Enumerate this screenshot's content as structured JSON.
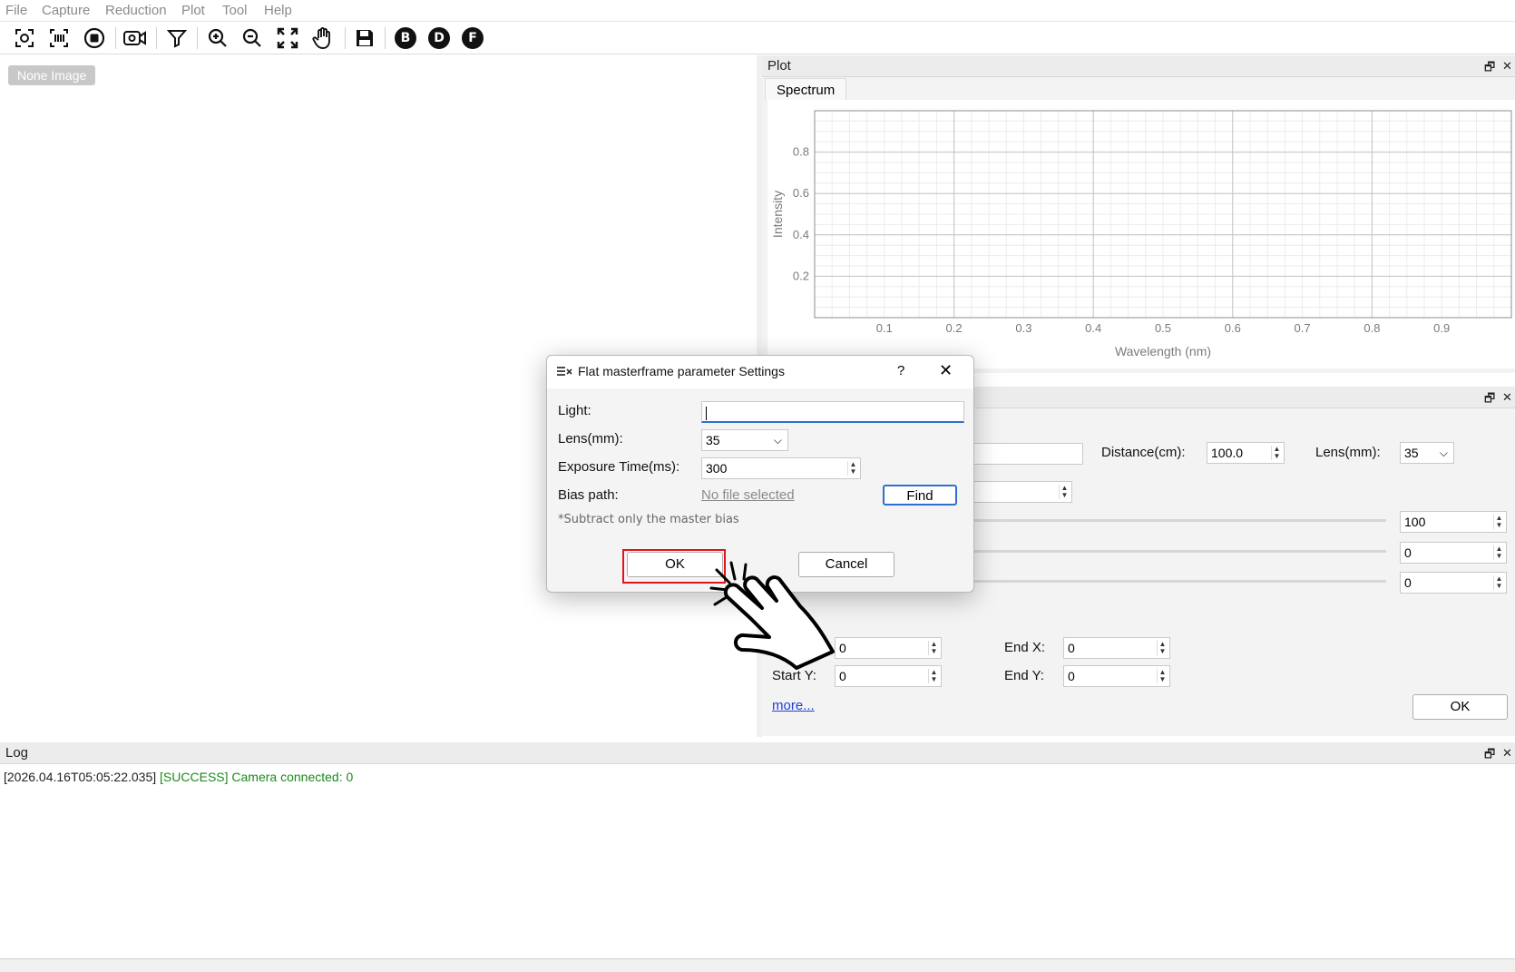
{
  "menu": [
    "File",
    "Capture",
    "Reduction",
    "Plot",
    "Tool",
    "Help"
  ],
  "toolbar": {
    "letters": [
      "B",
      "D",
      "F"
    ]
  },
  "image_area": {
    "badge": "None Image"
  },
  "plot_dock": {
    "title": "Plot",
    "tab": "Spectrum",
    "chart_data": {
      "type": "line",
      "title": "",
      "xlabel": "Wavelength (nm)",
      "ylabel": "Intensity",
      "xlim": [
        0,
        1
      ],
      "ylim": [
        0,
        1
      ],
      "x_ticks": [
        "0.1",
        "0.2",
        "0.3",
        "0.4",
        "0.5",
        "0.6",
        "0.7",
        "0.8",
        "0.9"
      ],
      "y_ticks": [
        "0.2",
        "0.4",
        "0.6",
        "0.8"
      ],
      "grid": true,
      "series": []
    }
  },
  "settings_dock": {
    "distance_label": "Distance(cm):",
    "distance_value": "100.0",
    "lens_label": "Lens(mm):",
    "lens_value": "35",
    "slider_values": [
      "100",
      "0",
      "0"
    ],
    "start_x_value": "0",
    "end_x_label": "End X:",
    "end_x_value": "0",
    "start_y_label": "Start Y:",
    "start_y_value": "0",
    "end_y_label": "End Y:",
    "end_y_value": "0",
    "more_link": "more...",
    "ok_label": "OK"
  },
  "log": {
    "title": "Log",
    "timestamp": "[2026.04.16T05:05:22.035]",
    "message": "[SUCCESS] Camera connected: 0"
  },
  "dialog": {
    "title": "Flat masterframe parameter Settings",
    "help": "?",
    "light_label": "Light:",
    "light_value": "",
    "lens_label": "Lens(mm):",
    "lens_value": "35",
    "exposure_label": "Exposure Time(ms):",
    "exposure_value": "300",
    "bias_label": "Bias path:",
    "bias_value": "No file selected",
    "find_label": "Find",
    "note": "*Subtract only the master bias",
    "ok_label": "OK",
    "cancel_label": "Cancel"
  },
  "colors": {
    "success": "#1a8a1a",
    "highlight": "#e0141c",
    "link": "#1f3fd6",
    "focus": "#2f6fd0"
  }
}
